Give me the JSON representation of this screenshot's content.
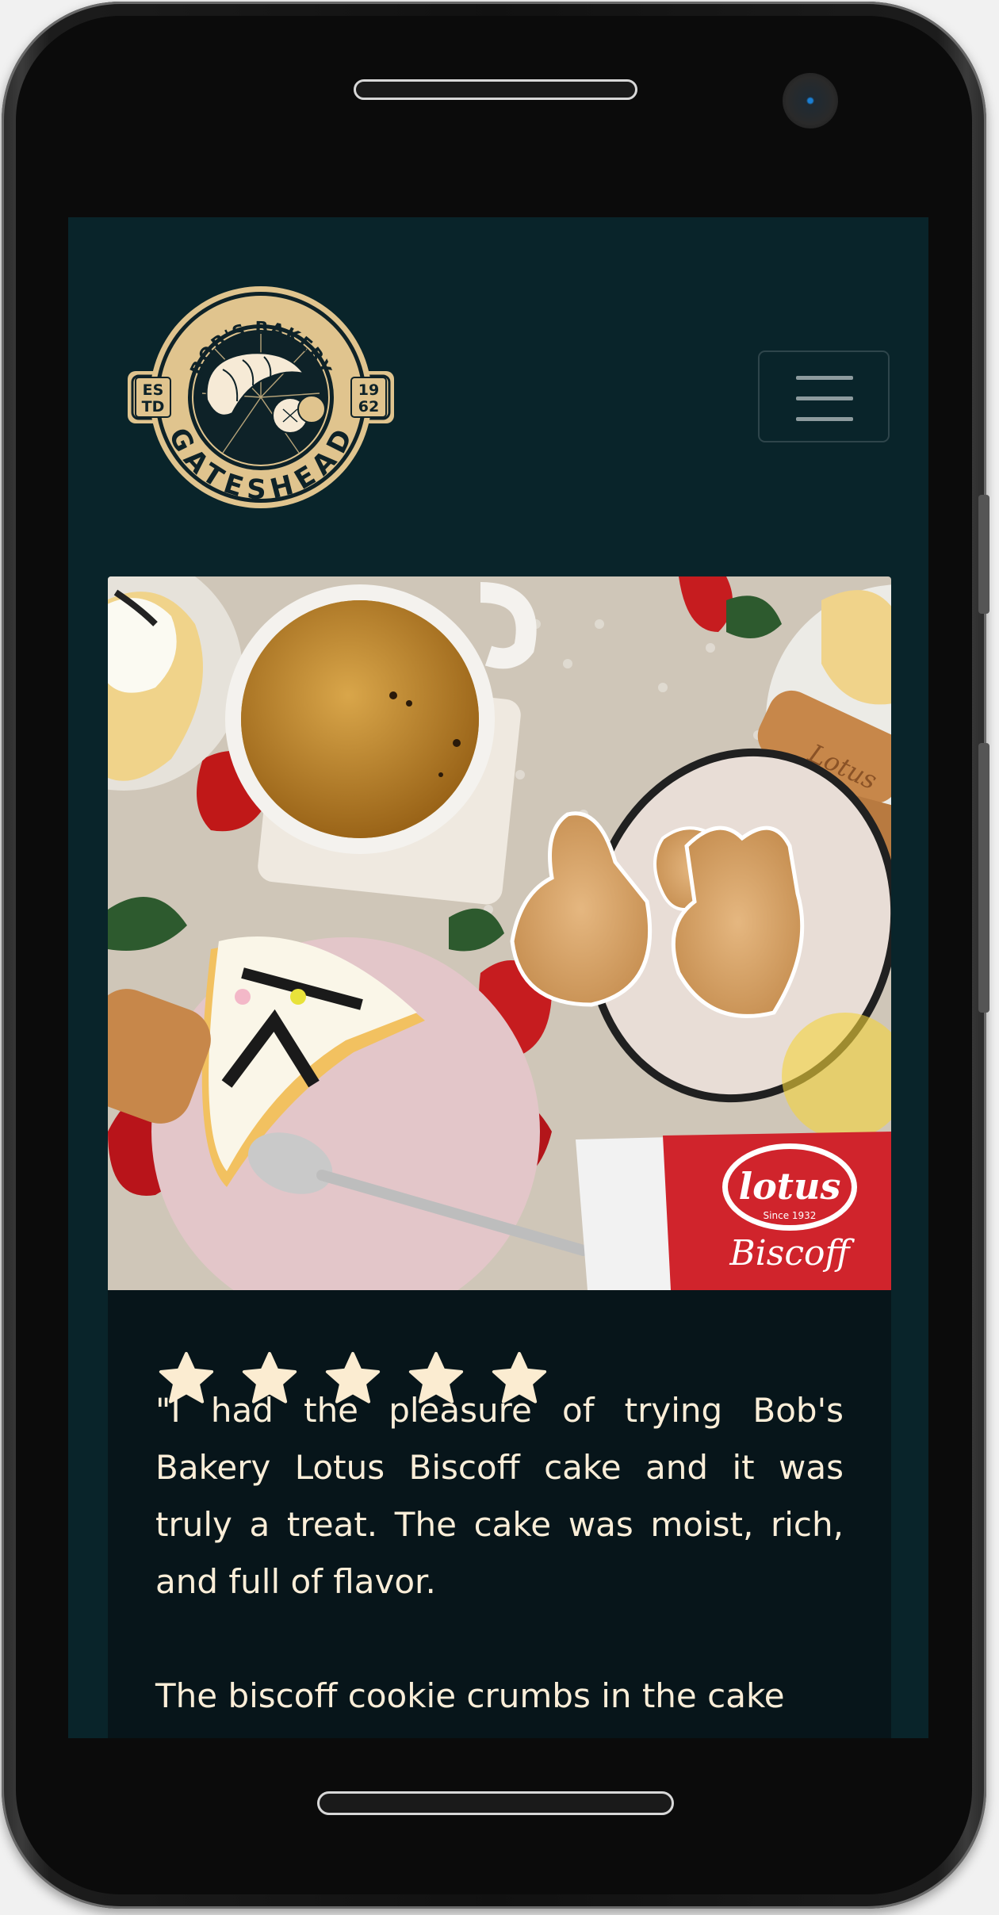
{
  "device": {
    "type": "phone",
    "frame_color": "#101010",
    "icons": [
      "speaker-slot",
      "front-camera",
      "home-indicator"
    ]
  },
  "header": {
    "logo": {
      "arc_top": "BOB'S BAKERY",
      "arc_bottom": "GATESHEAD",
      "left_badge_line1": "ES",
      "left_badge_line2": "TD",
      "right_badge_line1": "19",
      "right_badge_line2": "62",
      "colors": {
        "gold": "#e0c48e",
        "dark": "#0e2228",
        "cream": "#f6ead6"
      }
    },
    "menu_icon": "hamburger-icon"
  },
  "testimonial": {
    "image_alt": "Tea cup, iced cookies and Lotus Biscoff cake on a table",
    "image_texts": {
      "brand": "lotus",
      "since": "Since 1932",
      "product": "Biscoff",
      "tray_text": "Lotus"
    },
    "rating": 5,
    "star_color": "#fbecd1",
    "text_paragraph_1": "\"I had the pleasure of trying Bob's Bakery Lotus Biscoff cake and it was truly a treat. The cake was moist, rich, and full of flavor.",
    "text_paragraph_2": "The biscoff cookie crumbs in the cake"
  },
  "colors": {
    "page_background": "#09242a",
    "card_background": "#07151a",
    "text": "#fbeed8"
  }
}
